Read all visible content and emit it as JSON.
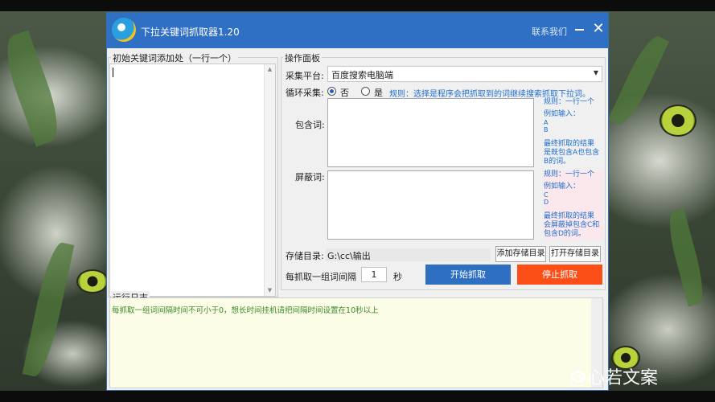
{
  "window": {
    "title": "下拉关键词抓取器1.20",
    "contact_label": "联系我们",
    "close_glyph": "✕"
  },
  "left_panel": {
    "group_label": "初始关键词添加处（一行一个）"
  },
  "ops_panel": {
    "group_label": "操作面板",
    "platform_label": "采集平台:",
    "platform_value": "百度搜索电脑端",
    "loop_label": "循环采集:",
    "loop_no": "否",
    "loop_yes": "是",
    "loop_selected": "否",
    "rule_text": "规则：选择是程序会把抓取到的词继续搜索抓取下拉词。",
    "include_label": "包含词:",
    "include_help": [
      "规则：一行一个",
      "例如输入：",
      "A",
      "B",
      "最终抓取的结果",
      "是既包含A也包含",
      "B的词。"
    ],
    "exclude_label": "屏蔽词:",
    "exclude_help": [
      "规则：一行一个",
      "例如输入：",
      "C",
      "D",
      "最终抓取的结果",
      "会屏蔽掉包含C和",
      "包含D的词。"
    ],
    "save_dir_label": "存储目录:",
    "save_dir_value": "G:\\cc\\输出",
    "add_dir_button": "添加存储目录",
    "open_dir_button": "打开存储目录",
    "interval_label": "每抓取一组词间隔",
    "interval_value": "1",
    "interval_unit": "秒",
    "start_button": "开始抓取",
    "stop_button": "停止抓取"
  },
  "log": {
    "group_label": "运行日志",
    "lines": [
      "每抓取一组词间隔时间不可小于0，想长时间挂机请把间隔时间设置在10秒以上"
    ]
  },
  "watermark": "@心若文案",
  "colors": {
    "titlebar": "#2f6fc4",
    "start_button": "#2e6fc2",
    "stop_button": "#fb4f17",
    "help_text": "#1f6fcc",
    "log_text": "#3a8a2a"
  }
}
